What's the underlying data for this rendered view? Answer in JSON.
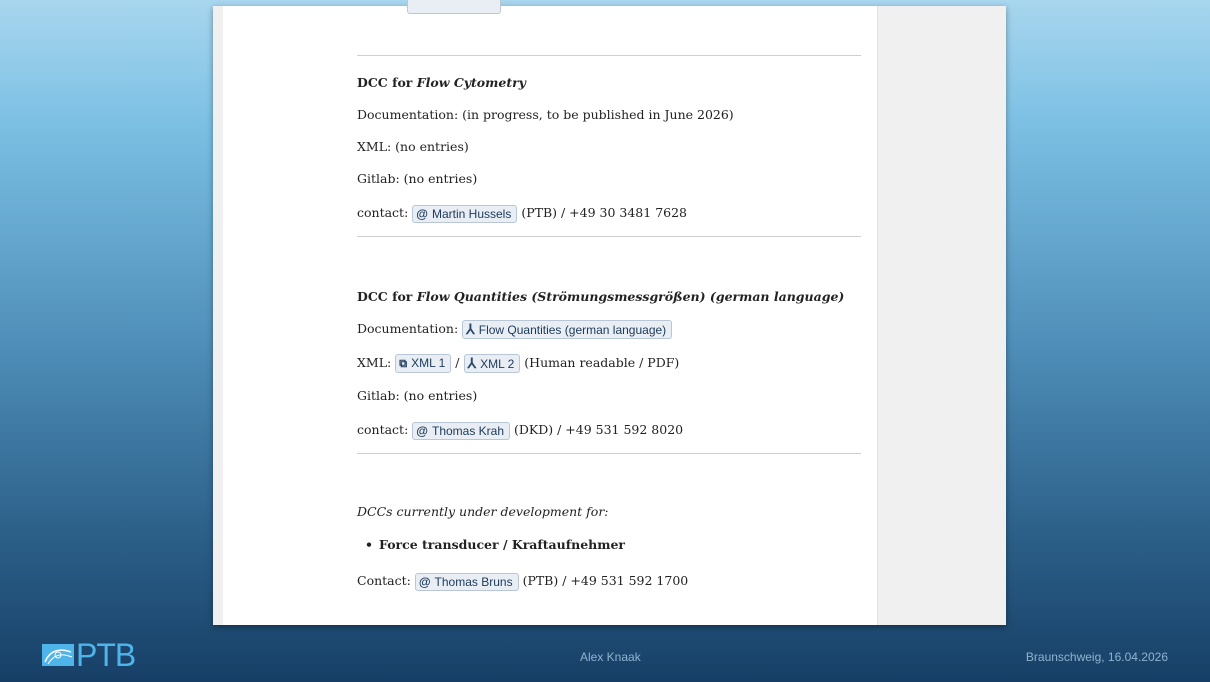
{
  "sections": {
    "flow_cytometry": {
      "title_prefix": "DCC for ",
      "title_em": "Flow Cytometry",
      "documentation": "Documentation: (in progress, to be published in June 2026)",
      "xml": "XML: (no entries)",
      "gitlab": "Gitlab: (no entries)",
      "contact_label": "contact:",
      "contact_name": "Martin Hussels",
      "contact_suffix": "(PTB) / +49 30 3481 7628"
    },
    "flow_quantities": {
      "title_prefix": "DCC for ",
      "title_em": "Flow Quantities (Strömungsmessgrößen) (german language)",
      "documentation_label": "Documentation:",
      "documentation_link": "Flow Quantities (german language)",
      "xml_label": "XML:",
      "xml_link_1": "XML 1",
      "xml_sep": "/",
      "xml_link_2": "XML 2",
      "xml_suffix": "(Human readable / PDF)",
      "gitlab": "Gitlab: (no entries)",
      "contact_label": "contact:",
      "contact_name": "Thomas Krah",
      "contact_suffix": "(DKD) / +49 531 592 8020"
    },
    "development": {
      "intro": "DCCs currently under development for:",
      "items": [
        "Force transducer / Kraftaufnehmer"
      ],
      "contact_label": "Contact:",
      "contact_name": "Thomas Bruns",
      "contact_suffix": "(PTB) / +49 531 592 1700"
    }
  },
  "footer": {
    "logo_text": "PTB",
    "presenter": "Alex Knaak",
    "place_date": "Braunschweig, 16.04.2026"
  },
  "icons": {
    "email": "@",
    "external_link": "⧉",
    "pdf": "⅄"
  },
  "colors": {
    "logo": "#4fb4ea",
    "button_bg": "#e9eef4"
  }
}
